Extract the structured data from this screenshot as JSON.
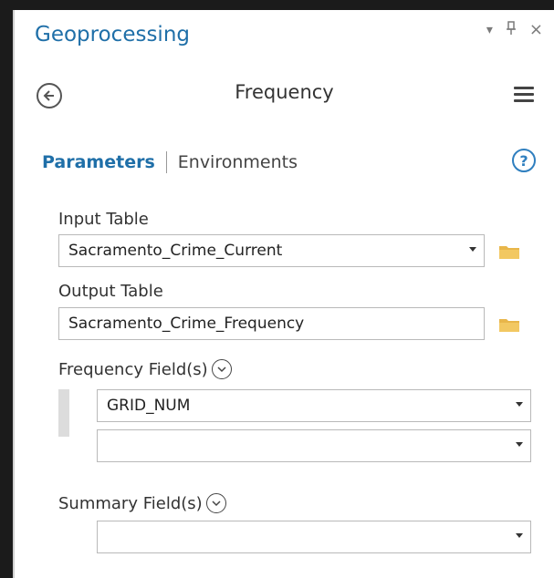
{
  "panel": {
    "title": "Geoprocessing",
    "controls": {
      "dropdown_icon": "dropdown-caret-icon",
      "pin_icon": "pin-icon",
      "close_icon": "close-icon",
      "pin_glyph": "%4",
      "close_glyph": "×",
      "dropdown_glyph": "▾"
    }
  },
  "tool": {
    "name": "Frequency"
  },
  "tabs": {
    "parameters": "Parameters",
    "environments": "Environments"
  },
  "params": {
    "input_table": {
      "label": "Input Table",
      "value": "Sacramento_Crime_Current"
    },
    "output_table": {
      "label": "Output Table",
      "value": "Sacramento_Crime_Frequency"
    },
    "frequency_fields": {
      "label": "Frequency Field(s)",
      "values": [
        "GRID_NUM",
        ""
      ]
    },
    "summary_fields": {
      "label": "Summary Field(s)",
      "values": [
        ""
      ]
    }
  },
  "colors": {
    "accent": "#1f6fa8",
    "folder": "#e8b64a"
  }
}
